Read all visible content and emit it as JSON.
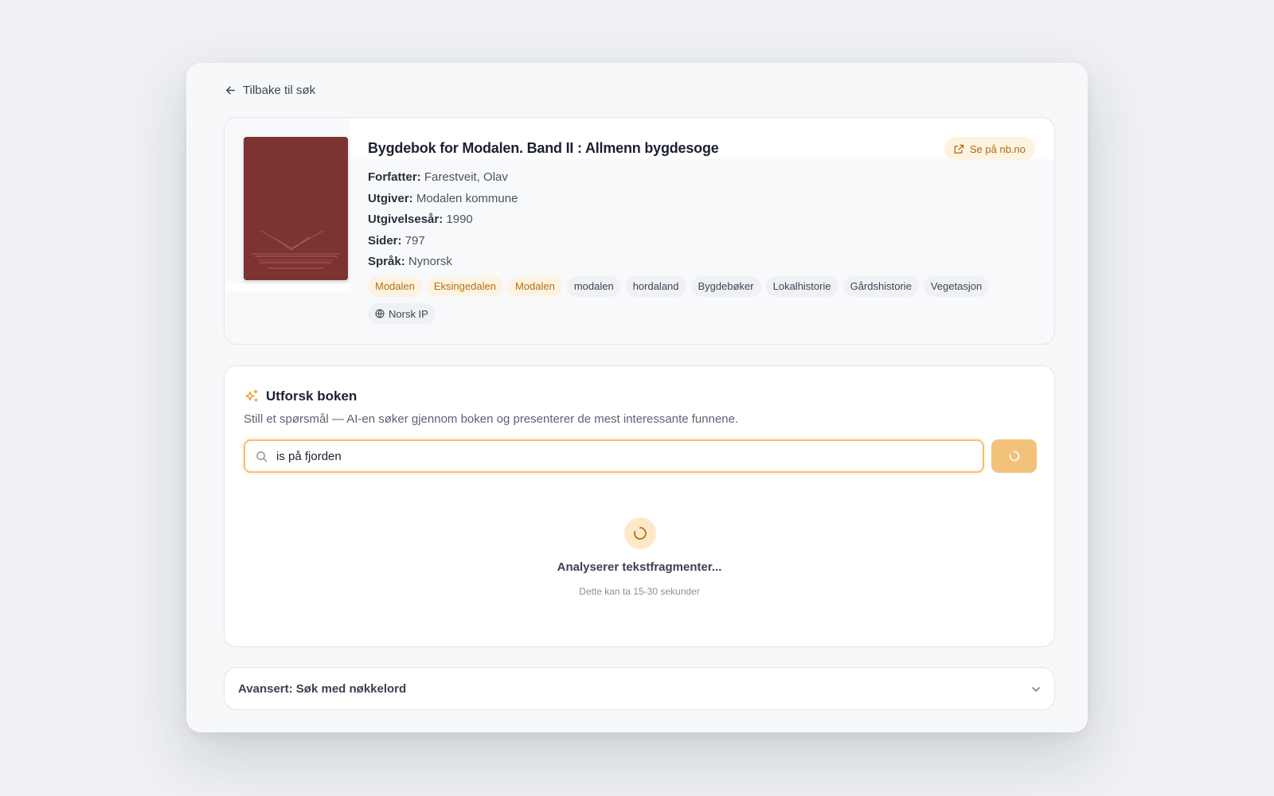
{
  "nav": {
    "back_label": "Tilbake til søk"
  },
  "book": {
    "title": "Bygdebok for Modalen. Band II : Allmenn bygdesoge",
    "external_link": "Se på nb.no",
    "meta": [
      {
        "key": "Forfatter:",
        "value": "Farestveit, Olav"
      },
      {
        "key": "Utgiver:",
        "value": "Modalen kommune"
      },
      {
        "key": "Utgivelsesår:",
        "value": "1990"
      },
      {
        "key": "Sider:",
        "value": "797"
      },
      {
        "key": "Språk:",
        "value": "Nynorsk"
      }
    ],
    "tags": [
      {
        "label": "Modalen",
        "style": "warm"
      },
      {
        "label": "Eksingedalen",
        "style": "warm"
      },
      {
        "label": "Modalen",
        "style": "warm"
      },
      {
        "label": "modalen",
        "style": "plain"
      },
      {
        "label": "hordaland",
        "style": "plain"
      },
      {
        "label": "Bygdebøker",
        "style": "plain"
      },
      {
        "label": "Lokalhistorie",
        "style": "plain"
      },
      {
        "label": "Gårdshistorie",
        "style": "plain"
      },
      {
        "label": "Vegetasjon",
        "style": "plain"
      }
    ],
    "access_label": "Norsk IP",
    "cover_color": "#7e3333"
  },
  "explore": {
    "title": "Utforsk boken",
    "subtitle": "Still et spørsmål — AI-en søker gjennom boken og presenterer de mest interessante funnene.",
    "query_value": "is på fjorden",
    "status_main": "Analyserer tekstfragmenter...",
    "status_sub": "Dette kan ta 15-30 sekunder",
    "accent_color": "#f2c27a"
  },
  "advanced": {
    "label": "Avansert: Søk med nøkkelord"
  }
}
